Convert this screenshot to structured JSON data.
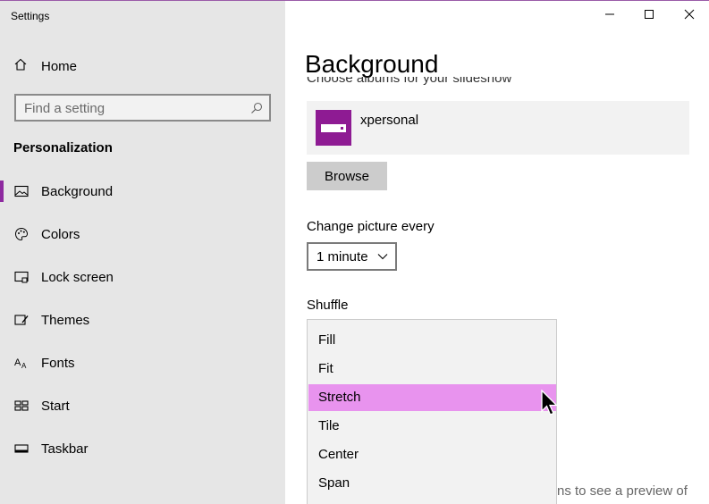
{
  "window": {
    "title": "Settings"
  },
  "sidebar": {
    "home_label": "Home",
    "search_placeholder": "Find a setting",
    "section_title": "Personalization",
    "items": [
      {
        "label": "Background",
        "icon": "picture-icon",
        "selected": true
      },
      {
        "label": "Colors",
        "icon": "palette-icon"
      },
      {
        "label": "Lock screen",
        "icon": "lock-screen-icon"
      },
      {
        "label": "Themes",
        "icon": "themes-brush-icon"
      },
      {
        "label": "Fonts",
        "icon": "fonts-icon"
      },
      {
        "label": "Start",
        "icon": "start-tiles-icon"
      },
      {
        "label": "Taskbar",
        "icon": "taskbar-icon"
      }
    ]
  },
  "main": {
    "title": "Background",
    "albums_label": "Choose albums for your slideshow",
    "album_name": "xpersonal",
    "browse_label": "Browse",
    "change_picture_label": "Change picture every",
    "change_picture_value": "1 minute",
    "shuffle_label": "Shuffle",
    "fit_options": [
      "Fill",
      "Fit",
      "Stretch",
      "Tile",
      "Center",
      "Span"
    ],
    "highlighted_option": "Stretch",
    "partial_text": "ns to see a preview of"
  },
  "colors": {
    "accent": "#8e2aa0",
    "album_thumb": "#8e1b93",
    "highlight": "#e893ee"
  }
}
